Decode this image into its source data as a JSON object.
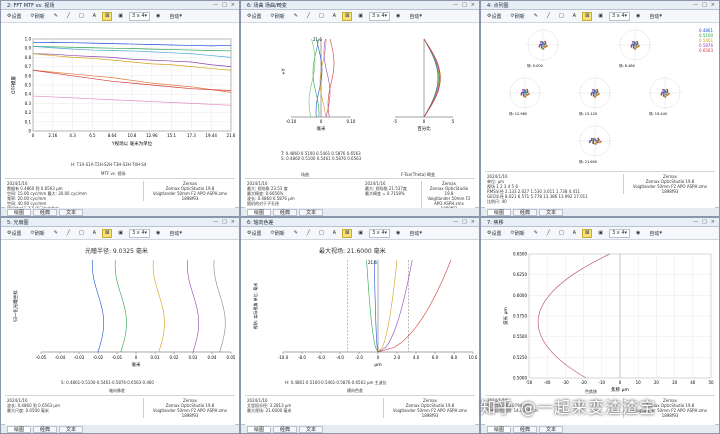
{
  "panes": [
    {
      "title": "2: FFT MTF vs. 视场",
      "axis_top": "1.0",
      "axis_y": "OTF模量",
      "axis_x": "Y视场以 毫米为单位",
      "xticks": [
        "0",
        "2.16",
        "4.3",
        "6.5",
        "8.64",
        "10.8",
        "12.96",
        "15.1",
        "17.3",
        "19.44",
        "21.6"
      ],
      "yticks": [
        "1.0",
        "0.9",
        "0.8",
        "0.7",
        "0.6",
        "0.5",
        "0.4",
        "0.3",
        "0.2",
        "0.1",
        "0"
      ],
      "legend": "H: T1A·S1A·T2H·S2H·T3H·S3H·T4H·S4",
      "caption": "MTF vs. 视场",
      "info_left": [
        "2024/1/16",
        "数据有 0.4860 到 0.6563 μm",
        "空间: 15.00 cyc/mm     最大: 30.00 cyc/mm",
        "频率: 20.00 cyc/mm",
        "空间: 40.00 cyc/mm",
        "随机的对于子孔径已在文件中"
      ],
      "info_right": [
        "Zemax",
        "Zemax OpticStudio 19.8",
        "",
        "Voigtlander 50mm F2 APO ASPH.zmx",
        "1898f93"
      ],
      "tabs": [
        "绘图",
        "经典",
        "文本"
      ]
    },
    {
      "title": "6: 场曲 场曲/畸变",
      "field_label": "21.6",
      "left_x": [
        "-0.10",
        "0",
        "0.10"
      ],
      "right_x": [
        "-5",
        "0",
        "5"
      ],
      "left_caption": "毫米",
      "right_caption": "百分比",
      "legend_lines": [
        "T: 0.4860  0.5100  0.5461  0.5876  0.6563",
        "S: 0.4860  0.5100  0.5461  0.5876  0.6563"
      ],
      "caption_a": "场曲",
      "caption_b": "F-Tan(Theta) 畸变",
      "info_left": [
        "2024/1/16",
        "最大: 视场角 23.53 度",
        "最大畸变: 0.6656%",
        "波长: 0.4860 0.5876 μm",
        "随机的对于子孔径"
      ],
      "info_mid": [
        "2024/1/16",
        "最大: 视场角 21.537度",
        "最大畸变 = 0.7158%"
      ],
      "info_right": [
        "Zemax",
        "Zemax OpticStudio 19.8",
        "",
        "Voigtlander 50mm F2 APO ASPH.zmx",
        "1898f93"
      ],
      "tabs": [
        "绘图",
        "经典",
        "文本"
      ]
    },
    {
      "title": "4: 点列图",
      "legend": [
        "0.4861",
        "0.5100",
        "0.5461",
        "0.5876",
        "0.6563"
      ],
      "spot_labels": [
        "场: 0.000",
        "场: 6.480",
        "场: 12.960",
        "场: 15.120",
        "场: 19.440",
        "场: 21.600"
      ],
      "info_left": [
        "2024/1/16",
        "单位: μm",
        "视场    1      2      3      4      5      6",
        "RMS半径  2.133  2.027  1.530  3.011  1.738  4.411",
        "GEO半径  8.021  6.571  5.778  13.386  13.992  17.011",
        "比例尺: 40"
      ],
      "info_right": [
        "Zemax",
        "Zemax OpticStudio 19.8",
        "",
        "Voigtlander 50mm F2 APO ASPH.zmx",
        "1898f93"
      ],
      "tabs": [
        "绘图",
        "经典",
        "文本"
      ]
    },
    {
      "title": "5: 光扇图",
      "caption_top": "光瞳半径: 9.0325 毫米",
      "axis_y": "归一化光瞳坐标",
      "xticks": [
        "-0.05",
        "-0.04",
        "-0.03",
        "-0.02",
        "-0.01",
        "0",
        "0.01",
        "0.02",
        "0.03",
        "0.04",
        "0.05"
      ],
      "axis_x": "毫米",
      "legend": "S: 0.4861·0.5100·0.5461·0.5876·0.6563·0.460",
      "caption": "轴向像差",
      "info_left": [
        "2024/1/16",
        "波长: 0.4860 到 0.6563 μm",
        "最大尺度: 0.0500 毫米"
      ],
      "info_right": [
        "Zemax",
        "Zemax OpticStudio 19.8",
        "",
        "Voigtlander 50mm F2 APO ASPH.zmx",
        "1898f93"
      ],
      "tabs": [
        "绘图",
        "经典",
        "文本"
      ]
    },
    {
      "title": "6: 轴向色差",
      "caption_top": "最大视场: 21.6000 毫米",
      "axis_y": "视场: 实际视角 单位: 毫米",
      "field_label": "21.6",
      "xticks": [
        "-10.0",
        "-8.0",
        "-6.0",
        "-4.0",
        "-2.0",
        "0",
        "2.0",
        "4.0",
        "6.0",
        "8.0",
        "10.0"
      ],
      "axis_x": "μm",
      "legend": "H: 0.4861·0.5100·0.5461·0.5876·0.6563 μm  主波长",
      "caption": "横向色差",
      "info_left": [
        "2024/1/16",
        "艾里斑半径: 3.2813 μm",
        "最大视场: 21.6000 毫米"
      ],
      "info_right": [
        "Zemax",
        "Zemax OpticStudio 19.8",
        "",
        "Voigtlander 50mm F2 APO ASPH.zmx",
        "1898f93"
      ],
      "tabs": [
        "绘图",
        "经典",
        "文本"
      ]
    },
    {
      "title": "7: 焦移",
      "yticks": [
        "0.6500",
        "0.6250",
        "0.6000",
        "0.5750",
        "0.5500",
        "0.5250",
        "0.5000"
      ],
      "axis_y": "波长 μm",
      "xticks": [
        "-50",
        "-40",
        "-30",
        "-20",
        "-10",
        "0",
        "10",
        "20",
        "30",
        "40",
        "50"
      ],
      "axis_x": "焦移 μm",
      "caption": "色焦移",
      "info_left": [
        "2024/1/16",
        "最大焦移: 60.0794 μm",
        "衍射极限范围: 14.4398 μm"
      ],
      "info_right": [
        "Zemax",
        "Zemax OpticStudio 19.8",
        "",
        "Voigtlander 50mm F2 APO ASPH.zmx",
        "1898f93"
      ],
      "tabs": [
        "绘图",
        "经典",
        "文本"
      ]
    }
  ],
  "toolbar": {
    "settings": "设置",
    "refresh": "刷新",
    "layout": "3 x 4",
    "auto": "自动",
    "more": "▾"
  },
  "watermark": "知乎 @一起来变渣渣宝",
  "colors": {
    "accent": "#2b6cb0",
    "title_bg": "#e8eef6"
  }
}
